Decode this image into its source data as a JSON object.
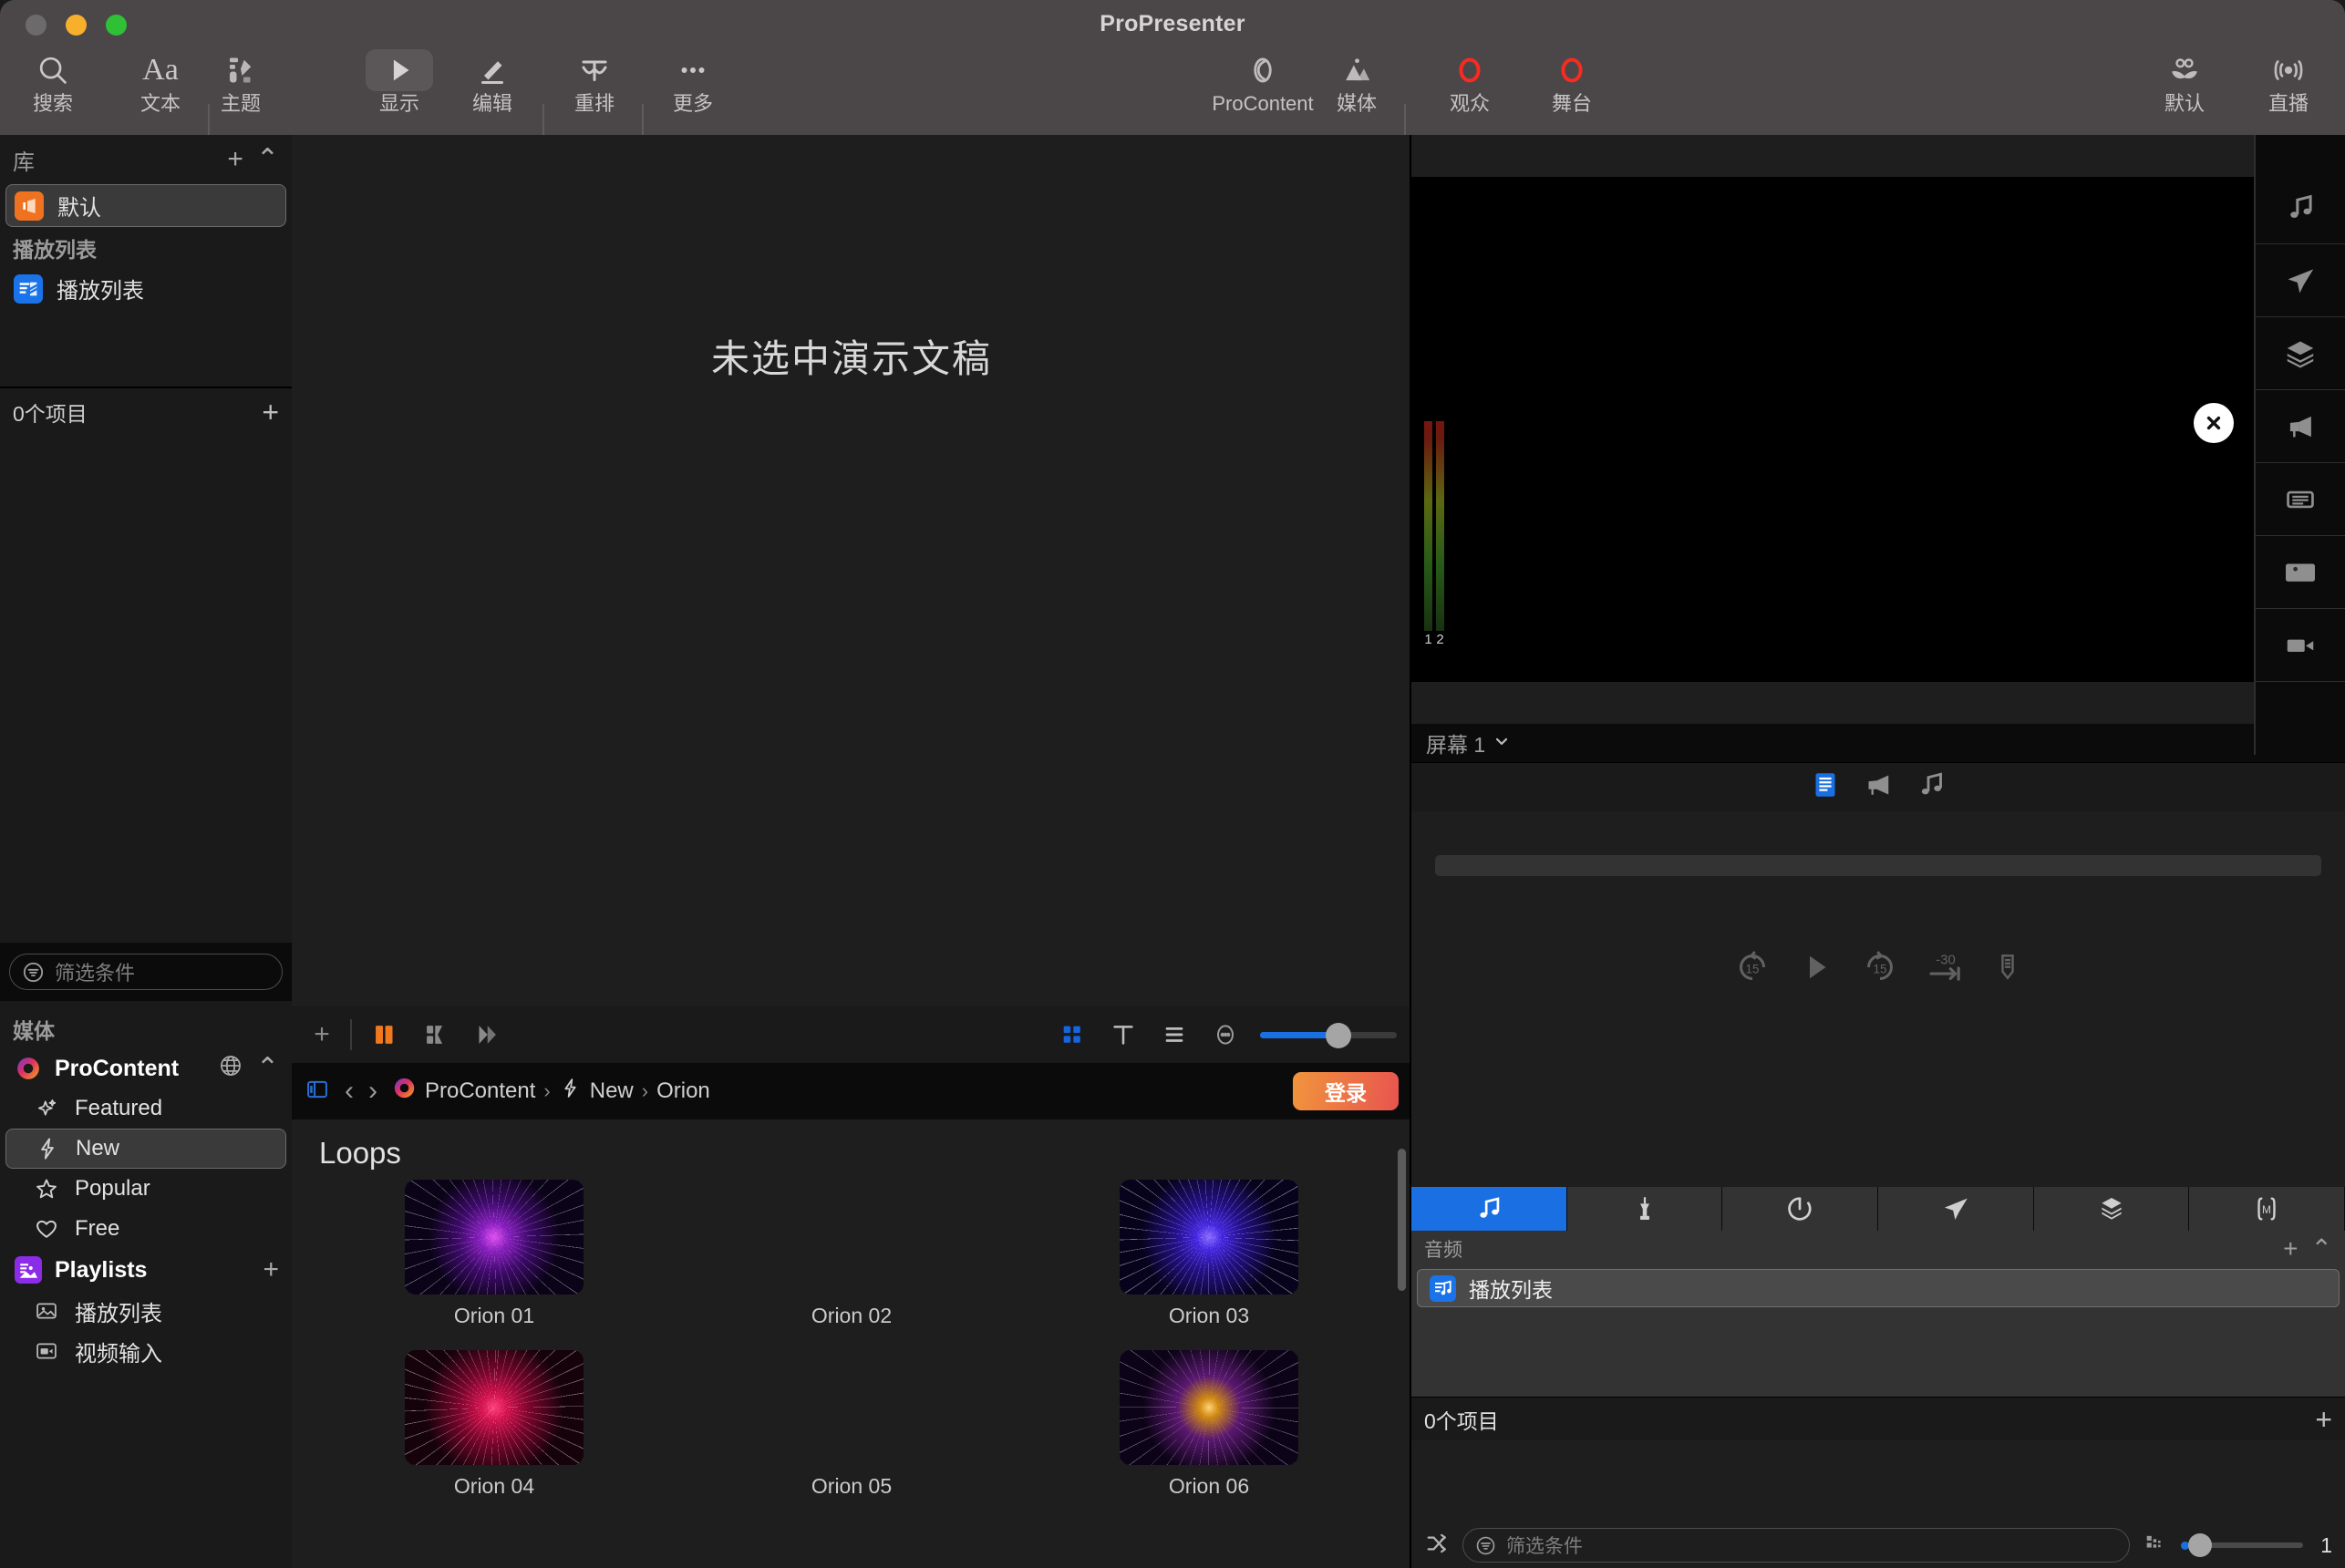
{
  "window": {
    "title": "ProPresenter",
    "traffic_lights": [
      "close",
      "minimize",
      "zoom"
    ]
  },
  "toolbar": {
    "items": [
      {
        "label": "搜索",
        "icon": "search-icon",
        "active": false
      },
      {
        "label": "文本",
        "icon": "text-Aa-icon",
        "active": false
      },
      {
        "label": "主题",
        "icon": "theme-icon",
        "active": false
      },
      {
        "label": "显示",
        "icon": "play-triangle-icon",
        "active": true
      },
      {
        "label": "编辑",
        "icon": "pencil-edit-icon",
        "active": false
      },
      {
        "label": "重排",
        "icon": "rearrange-icon",
        "active": false
      },
      {
        "label": "更多",
        "icon": "ellipsis-icon",
        "active": false
      }
    ],
    "right_items": [
      {
        "label": "ProContent",
        "icon": "procontent-spiral-icon",
        "active": false
      },
      {
        "label": "媒体",
        "icon": "media-mountain-icon",
        "active": false
      },
      {
        "label": "观众",
        "icon": "audience-record-icon",
        "active": false,
        "color": "#fa2a21"
      },
      {
        "label": "舞台",
        "icon": "stage-record-icon",
        "active": false,
        "color": "#fa2a21"
      },
      {
        "label": "默认",
        "icon": "mustache-default-icon",
        "active": false
      },
      {
        "label": "直播",
        "icon": "broadcast-live-icon",
        "active": false
      }
    ]
  },
  "sidebar": {
    "library": {
      "header": "库",
      "add_label": "+",
      "collapse_label": "⌃",
      "items": [
        {
          "label": "默认",
          "icon": "library-orange-icon",
          "selected": true
        }
      ]
    },
    "playlists_group_label": "播放列表",
    "playlist_items": [
      {
        "label": "播放列表",
        "icon": "playlist-blue-icon",
        "selected": false
      }
    ],
    "item_count": "0个项目",
    "item_add_label": "+",
    "filter_placeholder": "筛选条件",
    "media": {
      "header": "媒体",
      "procontent": {
        "label": "ProContent",
        "icon": "procontent-ring-icon",
        "globe_label": "globe",
        "collapse_label": "⌃",
        "items": [
          {
            "label": "Featured",
            "icon": "sparkle-icon",
            "selected": false
          },
          {
            "label": "New",
            "icon": "bolt-icon",
            "selected": true
          },
          {
            "label": "Popular",
            "icon": "star-outline-icon",
            "selected": false
          },
          {
            "label": "Free",
            "icon": "heart-outline-icon",
            "selected": false
          }
        ]
      },
      "playlists": {
        "label": "Playlists",
        "icon": "playlists-purple-icon",
        "add_label": "+",
        "items": [
          {
            "label": "播放列表",
            "icon": "image-playlist-icon",
            "selected": false
          },
          {
            "label": "视频输入",
            "icon": "video-input-icon",
            "selected": false
          }
        ]
      }
    }
  },
  "stage": {
    "empty_message": "未选中演示文稿",
    "bottom_bar": {
      "add_label": "+",
      "view_buttons": [
        {
          "name": "two-column-view",
          "active": true
        },
        {
          "name": "grid-view",
          "active": false
        },
        {
          "name": "next-view",
          "active": false
        }
      ],
      "right_buttons": [
        {
          "name": "grid-layout-icon",
          "active": true
        },
        {
          "name": "text-layout-icon",
          "active": false
        },
        {
          "name": "list-layout-icon",
          "active": false
        },
        {
          "name": "more-options-icon",
          "active": false
        }
      ],
      "zoom_value": 58
    }
  },
  "procontent_browser": {
    "sidebar_toggle": "sidebar-toggle-icon",
    "back_label": "‹",
    "forward_label": "›",
    "breadcrumb": [
      {
        "label": "ProContent",
        "icon": "procontent-ring-icon"
      },
      {
        "label": "New",
        "icon": "bolt-icon"
      },
      {
        "label": "Orion",
        "icon": ""
      }
    ],
    "breadcrumb_separator": "›",
    "login_label": "登录",
    "section_title": "Loops",
    "items": [
      {
        "label": "Orion 01",
        "has_thumb": true,
        "c1": "#7a18a8",
        "c2": "#c12ad0",
        "c3": "#2a0b4a"
      },
      {
        "label": "Orion 02",
        "has_thumb": false,
        "c1": "",
        "c2": "",
        "c3": ""
      },
      {
        "label": "Orion 03",
        "has_thumb": true,
        "c1": "#2b18c8",
        "c2": "#7a3ae8",
        "c3": "#120a40"
      },
      {
        "label": "Orion 04",
        "has_thumb": true,
        "c1": "#c0114a",
        "c2": "#f0255e",
        "c3": "#40020f"
      },
      {
        "label": "Orion 05",
        "has_thumb": false,
        "c1": "",
        "c2": "",
        "c3": ""
      },
      {
        "label": "Orion 06",
        "has_thumb": true,
        "c1": "#d08a10",
        "c2": "#7a2ad0",
        "c3": "#18081f"
      }
    ]
  },
  "right_panel": {
    "preview": {
      "audio_meter_labels": [
        "1",
        "2"
      ],
      "close_label": "✕"
    },
    "screen_selector": {
      "label": "屏幕 1",
      "chevron": "⌄"
    },
    "rail_icons": [
      "music-note-icon",
      "paper-plane-icon",
      "layers-icon",
      "megaphone-icon",
      "message-icon",
      "image-icon",
      "video-icon"
    ],
    "media_toolbar": [
      {
        "name": "slide-text-icon",
        "active": true
      },
      {
        "name": "announcement-icon",
        "active": false
      },
      {
        "name": "music-note-icon",
        "active": false
      }
    ],
    "transport": {
      "buttons": [
        {
          "name": "rewind-15-icon",
          "label": "15"
        },
        {
          "name": "play-icon",
          "label": ""
        },
        {
          "name": "forward-15-icon",
          "label": "15"
        },
        {
          "name": "jump-minus-30-icon",
          "label": "-30"
        },
        {
          "name": "cue-marker-icon",
          "label": ""
        }
      ]
    },
    "tabs": [
      {
        "name": "tab-audio",
        "icon": "music-note-icon",
        "active": true
      },
      {
        "name": "tab-mixer",
        "icon": "mixer-fader-icon",
        "active": false
      },
      {
        "name": "tab-timer",
        "icon": "timer-icon",
        "active": false
      },
      {
        "name": "tab-messages",
        "icon": "paper-plane-icon",
        "active": false
      },
      {
        "name": "tab-layers",
        "icon": "layers-icon",
        "active": false
      },
      {
        "name": "tab-macro",
        "icon": "macro-m-icon",
        "active": false
      }
    ],
    "audio_section": {
      "header": "音频",
      "add_label": "+",
      "collapse_label": "⌃",
      "items": [
        {
          "label": "播放列表",
          "icon": "audio-playlist-icon",
          "selected": true
        }
      ]
    },
    "item_count": "0个项目",
    "item_add_label": "+",
    "footer": {
      "shuffle_icon": "shuffle-icon",
      "filter_placeholder": "筛选条件",
      "thumbnail_size_icon": "thumbnail-size-icon",
      "zoom_value": "1"
    }
  }
}
